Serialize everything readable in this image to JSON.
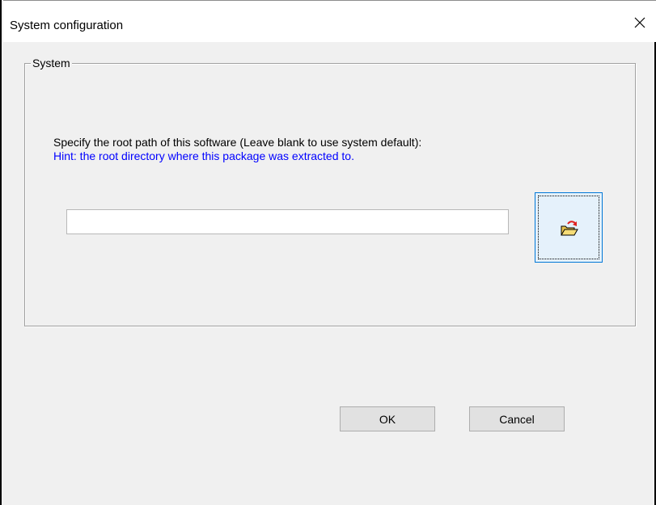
{
  "window": {
    "title": "System configuration"
  },
  "group": {
    "label": "System",
    "instruction": "Specify the root path of this software (Leave blank to use system default):",
    "hint": "Hint: the root directory where this package was extracted to.",
    "hint_color": "#0000ff"
  },
  "path_field": {
    "value": "",
    "placeholder": ""
  },
  "browse_button": {
    "icon": "open-folder-icon"
  },
  "buttons": {
    "ok_label": "OK",
    "cancel_label": "Cancel"
  },
  "colors": {
    "dialog_bg": "#f0f0f0",
    "focus_border": "#0078d7",
    "button_bg": "#e1e1e1"
  }
}
